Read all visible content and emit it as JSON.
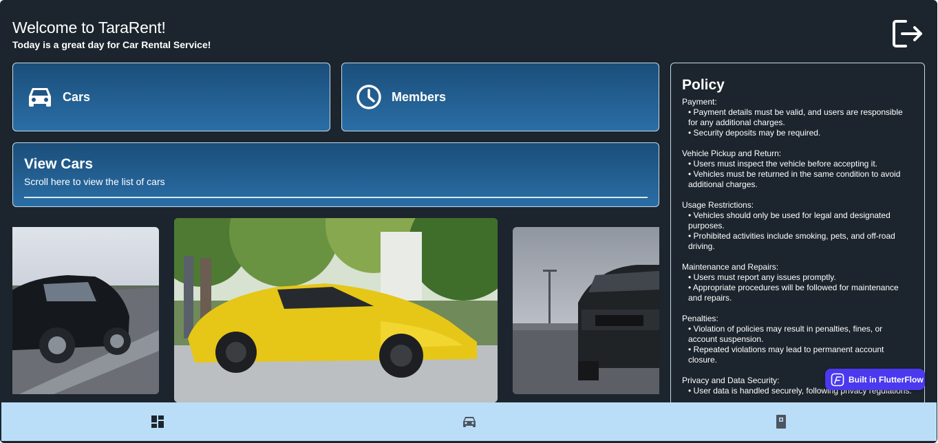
{
  "header": {
    "title": "Welcome to TaraRent!",
    "subtitle": "Today is a great day for Car Rental Service!"
  },
  "icons": {
    "logout": "logout-icon",
    "cars": "car-icon",
    "members": "clock-icon"
  },
  "tiles": {
    "cars_label": "Cars",
    "members_label": "Members"
  },
  "view_cars": {
    "title": "View Cars",
    "hint": "Scroll here to view the list of cars"
  },
  "carousel": {
    "slides": [
      "black-porsche",
      "yellow-lamborghini",
      "black-mustang"
    ]
  },
  "policy": {
    "title": "Policy",
    "sections": [
      {
        "heading": "Payment:",
        "items": [
          "• Payment details must be valid, and users are responsible for any additional charges.",
          "• Security deposits may be required."
        ]
      },
      {
        "heading": "Vehicle Pickup and Return:",
        "items": [
          "• Users must inspect the vehicle before accepting it.",
          "• Vehicles must be returned in the same condition to avoid additional charges."
        ]
      },
      {
        "heading": "Usage Restrictions:",
        "items": [
          "• Vehicles should only be used for legal and designated purposes.",
          "• Prohibited activities include smoking, pets, and off-road driving."
        ]
      },
      {
        "heading": "Maintenance and Repairs:",
        "items": [
          "• Users must report any issues promptly.",
          "• Appropriate procedures will be followed for maintenance and repairs."
        ]
      },
      {
        "heading": "Penalties:",
        "items": [
          "• Violation of policies may result in penalties, fines, or account suspension.",
          "• Repeated violations may lead to permanent account closure."
        ]
      },
      {
        "heading": "Privacy and Data Security:",
        "items": [
          "• User data is handled securely, following privacy regulations."
        ]
      }
    ]
  },
  "badge": {
    "label": "Built in FlutterFlow"
  },
  "nav": {
    "items": [
      "dashboard-icon",
      "car-icon",
      "book-icon"
    ]
  },
  "colors": {
    "background": "#1c252d",
    "tile_gradient_top": "#1b4e7a",
    "tile_gradient_bottom": "#2a6ea6",
    "nav_background": "#bbdef8",
    "badge": "#4b39ef"
  }
}
